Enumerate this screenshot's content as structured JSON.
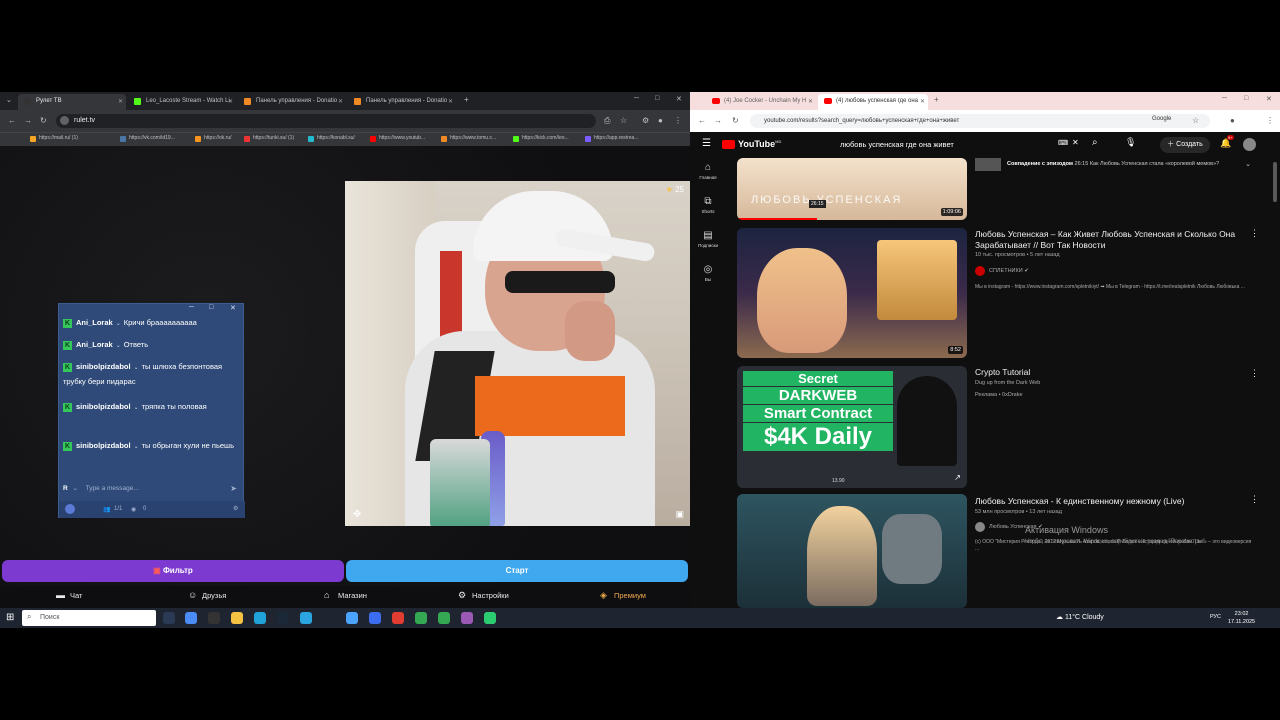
{
  "left_browser": {
    "tabs": [
      {
        "label": "Рулет ТВ",
        "active": true
      },
      {
        "label": "Leo_Lacoste Stream - Watch Li"
      },
      {
        "label": "Панель управления - Donatio"
      },
      {
        "label": "Панель управления - Donatio"
      }
    ],
    "url": "rulet.tv",
    "bookmarks": [
      "https://mail.ru/ (1)",
      "https://vk.com/id19...",
      "https://ok.ru/",
      "https://tunki.su/ (1)",
      "https://konabl.su/",
      "https://www.youtub...",
      "https://www.tomu.c...",
      "https://kick.com/leo...",
      "https://app.restrea..."
    ],
    "video": {
      "star_count": "25"
    },
    "chat": {
      "messages": [
        {
          "user": "Ani_Lorak",
          "text": "Кричи браааааааааа"
        },
        {
          "user": "Ani_Lorak",
          "text": "Ответь"
        },
        {
          "user": "sinibolpizdabol",
          "text": "ты шлюха безпонтовая трубку бери пидарас"
        },
        {
          "user": "sinibolpizdabol",
          "text": "тряпка ты половая"
        },
        {
          "user": "sinibolpizdabol",
          "text": "ты обрыган хули не пьешь"
        }
      ],
      "input_badge": "R",
      "input_placeholder": "Type a message...",
      "footer_users": "1/1",
      "footer_views": "0"
    },
    "buttons": {
      "filter": "Фильтр",
      "start": "Старт"
    },
    "bottom_nav": [
      "Чат",
      "Друзья",
      "Магазин",
      "Настройки",
      "Премиум"
    ]
  },
  "right_browser": {
    "tabs": [
      {
        "label": "(4) Joe Cocker - Unchain My H"
      },
      {
        "label": "(4) любовь успенская где она",
        "active": true
      }
    ],
    "url": "youtube.com/results?search_query=любовь+успенская+где+она+живет",
    "profile_label": "Google",
    "youtube": {
      "logo": "YouTube",
      "logo_suffix": "MD",
      "search_query": "любовь успенская где она живет",
      "create_label": "Создать",
      "notif_count": "9+",
      "sidebar": [
        "Главная",
        "Shorts",
        "Подписки",
        "Вы"
      ],
      "episode_label": "Совпадение с эпизодом",
      "episode_text": "26:15 Как Любовь Успенская стала «королевой мемов»?",
      "first_thumb": {
        "overlay": "ЛЮБОВЬ УСПЕНСКАЯ",
        "chapter": "26:15",
        "duration": "1:09:06"
      },
      "videos": [
        {
          "title": "Любовь Успенская – Как Живет Любовь Успенская и Сколько Она Зарабатывает // Вот Так Новости",
          "meta": "10 тыс. просмотров • 5 лет назад",
          "channel": "СПЛЕТНИКИ",
          "desc": "Мы в instagram - https://www.instagram.com/spletnikiyt/ ➡ Мы в Telegram - https://t.me/realspletnik Любовь Любовька ...",
          "duration": "8:52"
        },
        {
          "title": "Crypto Tutorial",
          "meta": "Dug up from the Dark Web",
          "channel": "Реклама • 0xDrake",
          "ad_lines": [
            "Secret",
            "DARKWEB",
            "Smart Contract",
            "$4K Daily"
          ],
          "ad_price": "13.90"
        },
        {
          "title": "Любовь Успенская - К единственному нежному (Live)",
          "meta": "53 млн просмотров • 13 лет назад",
          "channel": "Любовь Успенская",
          "desc": "(c) ООО \"Мистерия Рекордс\", 2012 Музыка И. Азаров, слова Р. Лесюк «История одной любви. Live» – это видеоверсия ..."
        }
      ]
    },
    "windows_activation": {
      "title": "Активация Windows",
      "subtitle": "Чтобы активировать Windows, перейдите в раздел \"Параметры\"."
    }
  },
  "taskbar": {
    "search_placeholder": "Поиск",
    "weather": "11°C  Cloudy",
    "lang": "РУС",
    "time": "23:02",
    "date": "17.11.2025"
  }
}
